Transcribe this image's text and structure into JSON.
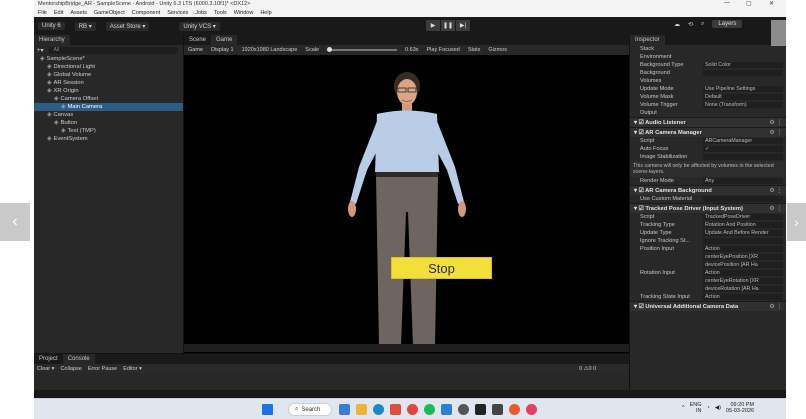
{
  "window": {
    "title": "MentorshipBridge_AR - SampleScene - Android - Unity 6.3 LTS (6000.3.10f1)* <DX12>",
    "minimize": "—",
    "maximize": "▢",
    "close": "✕"
  },
  "menu": [
    "File",
    "Edit",
    "Assets",
    "GameObject",
    "Component",
    "Services",
    "Jobs",
    "Tools",
    "Window",
    "Help"
  ],
  "toolbar": {
    "account": "Unity 6",
    "rb": "RB ▾",
    "asset_store": "Asset Store ▾",
    "vcs": "Unity VCS ▾",
    "layers": "Layers",
    "layout": "▾"
  },
  "hierarchy": {
    "tab": "Hierarchy",
    "search": "All",
    "rows": [
      {
        "label": "SampleScene*",
        "indent": 0,
        "sel": false
      },
      {
        "label": "Directional Light",
        "indent": 1,
        "sel": false
      },
      {
        "label": "Global Volume",
        "indent": 1,
        "sel": false
      },
      {
        "label": "AR Session",
        "indent": 1,
        "sel": false
      },
      {
        "label": "XR Origin",
        "indent": 1,
        "sel": false
      },
      {
        "label": "Camera Offset",
        "indent": 2,
        "sel": false
      },
      {
        "label": "Main Camera",
        "indent": 3,
        "sel": true
      },
      {
        "label": "Canvas",
        "indent": 1,
        "sel": false
      },
      {
        "label": "Button",
        "indent": 2,
        "sel": false
      },
      {
        "label": "Text (TMP)",
        "indent": 3,
        "sel": false
      },
      {
        "label": "EventSystem",
        "indent": 1,
        "sel": false
      }
    ]
  },
  "scene": {
    "tabs": [
      "Scene",
      "Game"
    ],
    "gamebar": {
      "mode": "Game",
      "display": "Display 1",
      "resolution": "1920x1080 Landscape",
      "scale_label": "Scale",
      "scale_value": "0.63x",
      "play_mode": "Play Focused",
      "stats": "Stats",
      "gizmos": "Gizmos"
    },
    "stop_label": "Stop"
  },
  "inspector": {
    "tab": "Inspector",
    "rows": [
      {
        "kind": "plain",
        "label": "Stack"
      },
      {
        "kind": "plain",
        "label": "Environment"
      },
      {
        "kind": "field",
        "label": "Background Type",
        "value": "Solid Color"
      },
      {
        "kind": "field",
        "label": "Background",
        "value": ""
      },
      {
        "kind": "plain",
        "label": "Volumes"
      },
      {
        "kind": "field",
        "label": "Update Mode",
        "value": "Use Pipeline Settings"
      },
      {
        "kind": "field",
        "label": "Volume Mask",
        "value": "Default"
      },
      {
        "kind": "field",
        "label": "Volume Trigger",
        "value": "None (Transform)"
      },
      {
        "kind": "plain",
        "label": "Output"
      },
      {
        "kind": "head",
        "label": "Audio Listener"
      },
      {
        "kind": "head",
        "label": "AR Camera Manager"
      },
      {
        "kind": "field",
        "label": "Script",
        "value": "ARCameraManager"
      },
      {
        "kind": "field",
        "label": "Auto Focus",
        "value": "✓"
      },
      {
        "kind": "field",
        "label": "Image Stabilization",
        "value": ""
      },
      {
        "kind": "note",
        "label": "This camera will only be affected by volumes in the selected scene-layers."
      },
      {
        "kind": "field",
        "label": "Render Mode",
        "value": "Any"
      },
      {
        "kind": "head",
        "label": "AR Camera Background"
      },
      {
        "kind": "field",
        "label": "Use Custom Material",
        "value": ""
      },
      {
        "kind": "head",
        "label": "Tracked Pose Driver (Input System)"
      },
      {
        "kind": "field",
        "label": "Script",
        "value": "TrackedPoseDriver"
      },
      {
        "kind": "field",
        "label": "Tracking Type",
        "value": "Rotation And Position"
      },
      {
        "kind": "field",
        "label": "Update Type",
        "value": "Update And Before Render"
      },
      {
        "kind": "field",
        "label": "Ignore Tracking St...",
        "value": ""
      },
      {
        "kind": "field",
        "label": "Position Input",
        "value": "Action"
      },
      {
        "kind": "field",
        "label": "",
        "value": "centerEyePosition [XR"
      },
      {
        "kind": "field",
        "label": "",
        "value": "devicePosition [AR Ha"
      },
      {
        "kind": "field",
        "label": "Rotation Input",
        "value": "Action"
      },
      {
        "kind": "field",
        "label": "",
        "value": "centerEyeRotation [XR"
      },
      {
        "kind": "field",
        "label": "",
        "value": "deviceRotation [AR Ha"
      },
      {
        "kind": "field",
        "label": "Tracking State Input",
        "value": "Action"
      },
      {
        "kind": "head",
        "label": "Universal Additional Camera Data"
      }
    ]
  },
  "console": {
    "tabs": [
      "Project",
      "Console"
    ],
    "clear": "Clear ▾",
    "collapse": "Collapse",
    "error_pause": "Error Pause",
    "editor": "Editor ▾",
    "counts": "0  ⚠0  0"
  },
  "taskbar": {
    "search": "Search",
    "lang": "ENG",
    "lang2": "IN",
    "time": "09:20 PM",
    "date": "05-03-2026"
  }
}
